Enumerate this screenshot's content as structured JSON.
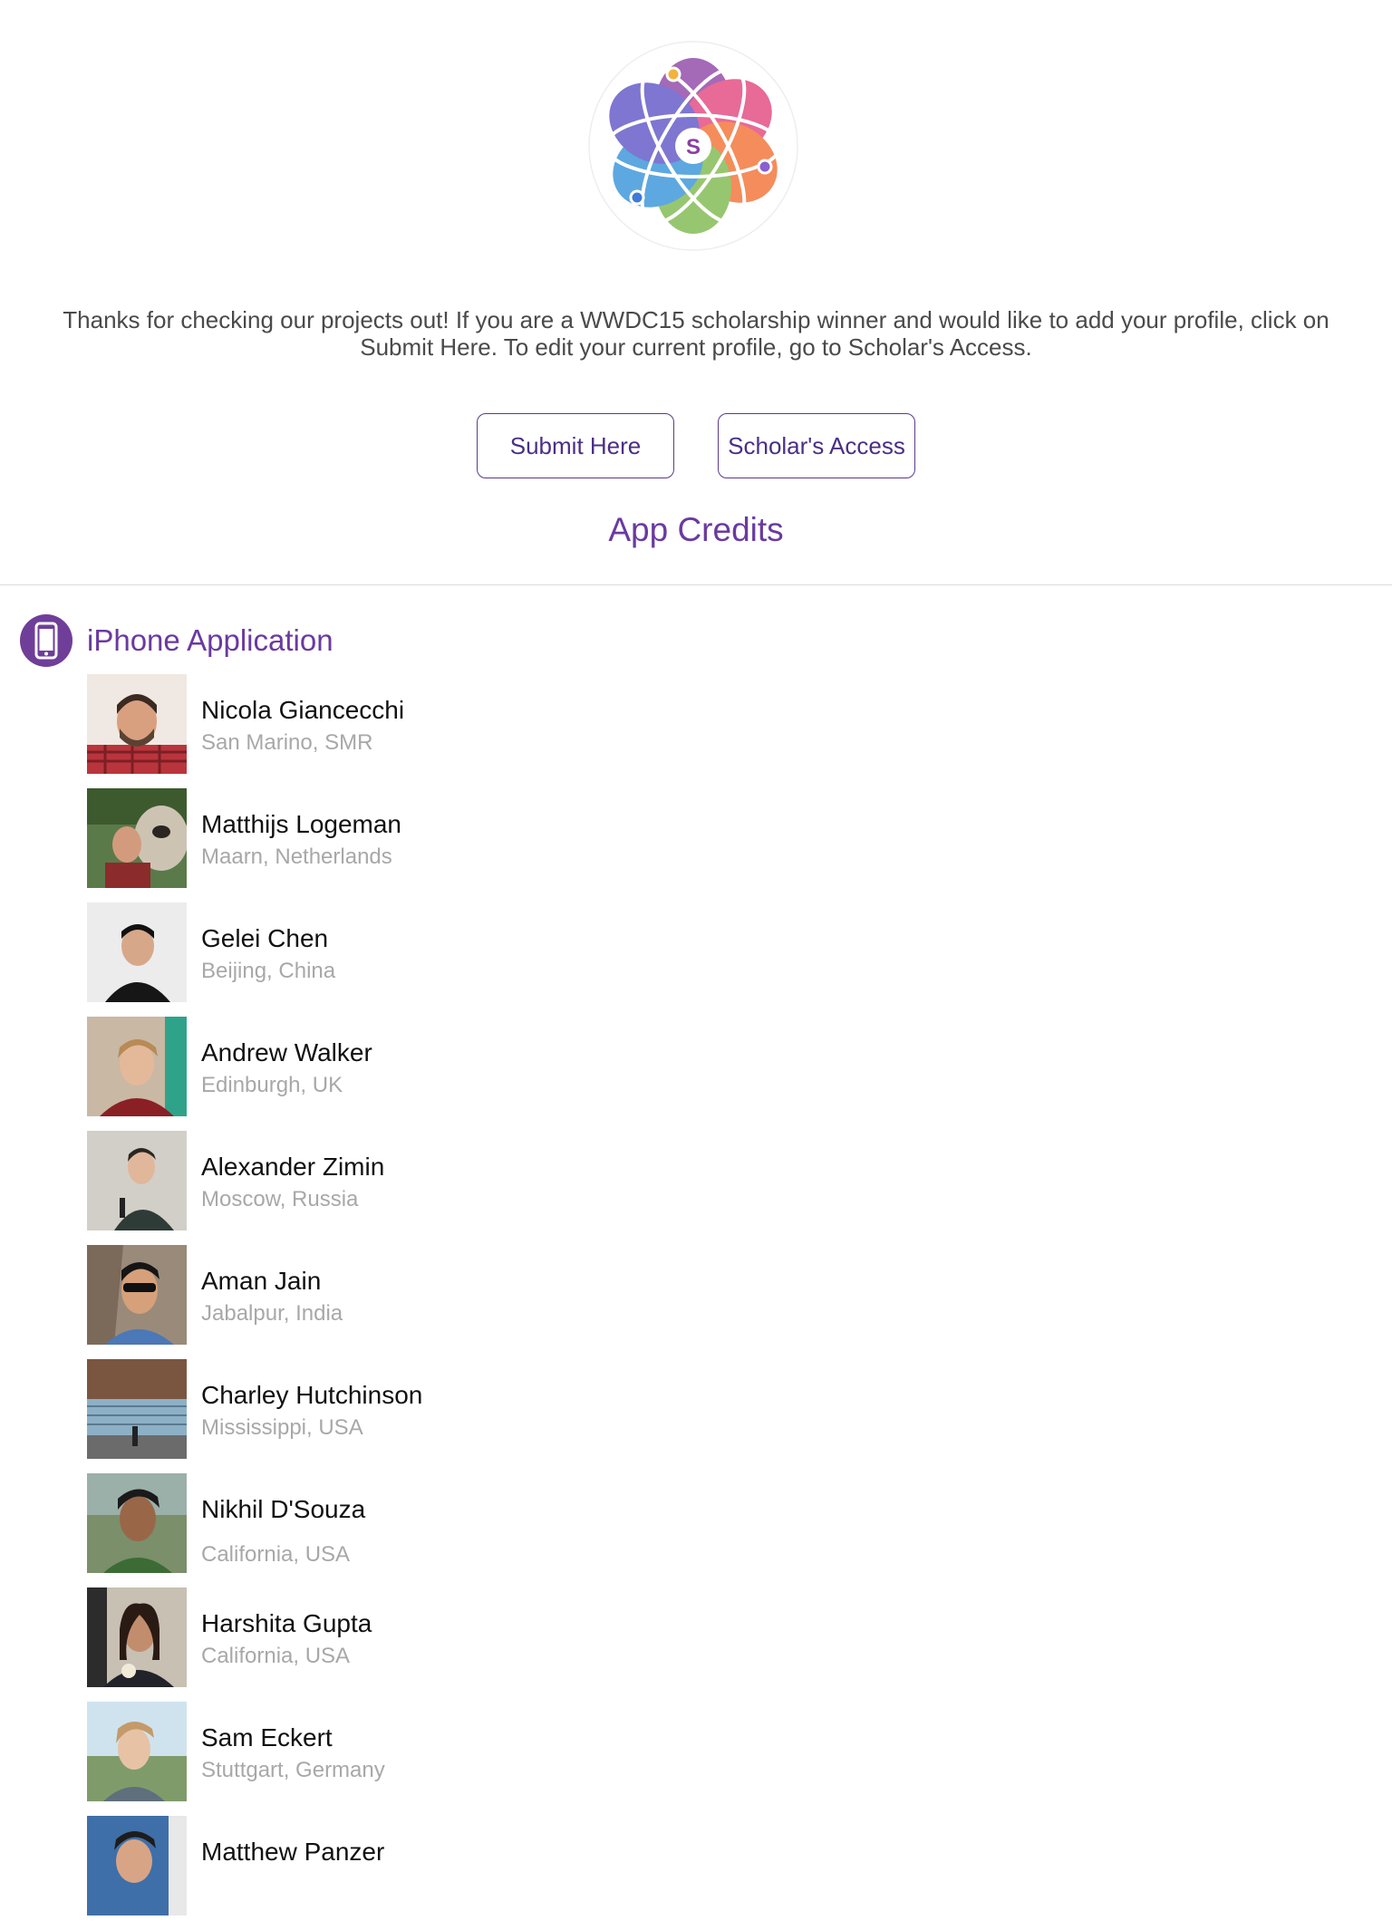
{
  "intro_text": "Thanks for checking our projects out! If you are a WWDC15 scholarship winner and would like to add your profile, click on Submit Here. To edit your current profile, go to Scholar's Access.",
  "buttons": {
    "submit_label": "Submit Here",
    "access_label": "Scholar's Access"
  },
  "app_credits_label": "App Credits",
  "logo_letter": "S",
  "section": {
    "title": "iPhone Application",
    "icon": "iphone-icon"
  },
  "people": [
    {
      "name": "Nicola Giancecchi",
      "location": "San Marino, SMR"
    },
    {
      "name": "Matthijs Logeman",
      "location": "Maarn, Netherlands"
    },
    {
      "name": "Gelei Chen",
      "location": "Beijing, China"
    },
    {
      "name": "Andrew Walker",
      "location": "Edinburgh, UK"
    },
    {
      "name": "Alexander Zimin",
      "location": "Moscow, Russia"
    },
    {
      "name": "Aman Jain",
      "location": "Jabalpur, India"
    },
    {
      "name": "Charley Hutchinson",
      "location": "Mississippi, USA"
    },
    {
      "name": "Nikhil D'Souza",
      "location": "California, USA"
    },
    {
      "name": "Harshita Gupta",
      "location": "California, USA"
    },
    {
      "name": "Sam Eckert",
      "location": "Stuttgart, Germany"
    },
    {
      "name": "Matthew Panzer",
      "location": ""
    }
  ],
  "colors": {
    "accent": "#6a3aa0",
    "button_text": "#4b2f86",
    "name_text": "#111111",
    "location_text": "#a8a8a8"
  }
}
